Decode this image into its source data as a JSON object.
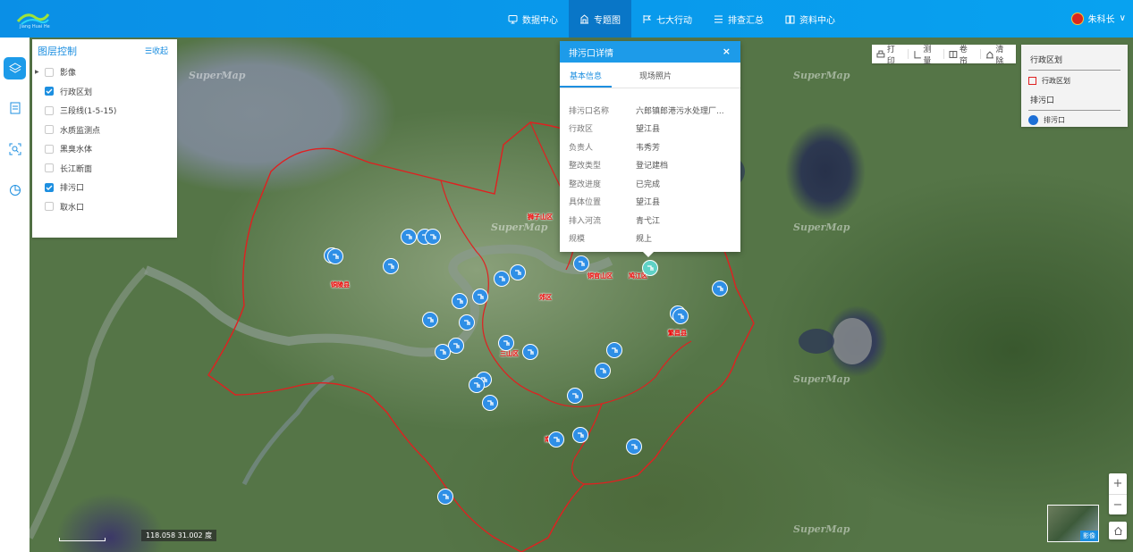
{
  "header": {
    "logo_text": "Jiang Huai He",
    "nav": [
      {
        "label": "数据中心",
        "icon": "monitor-icon"
      },
      {
        "label": "专题图",
        "icon": "building-icon",
        "active": true
      },
      {
        "label": "七大行动",
        "icon": "flag-icon"
      },
      {
        "label": "排查汇总",
        "icon": "list-icon"
      },
      {
        "label": "资料中心",
        "icon": "book-icon"
      }
    ],
    "user": "朱科长",
    "user_chevron": "∨"
  },
  "layer_panel": {
    "title": "图层控制",
    "collapse": "☰收起",
    "items": [
      {
        "label": "影像",
        "checked": false,
        "expandable": true
      },
      {
        "label": "行政区划",
        "checked": true
      },
      {
        "label": "三段线(1-5-15)",
        "checked": false
      },
      {
        "label": "水质监测点",
        "checked": false
      },
      {
        "label": "黑臭水体",
        "checked": false
      },
      {
        "label": "长江断面",
        "checked": false
      },
      {
        "label": "排污口",
        "checked": true
      },
      {
        "label": "取水口",
        "checked": false
      }
    ]
  },
  "popup": {
    "title": "排污口详情",
    "close": "×",
    "tabs": [
      "基本信息",
      "现场照片"
    ],
    "rows": [
      {
        "key": "排污口名称",
        "value": "六郎镇郎港污水处理厂..."
      },
      {
        "key": "行政区",
        "value": "望江县"
      },
      {
        "key": "负责人",
        "value": "韦秀芳"
      },
      {
        "key": "整改类型",
        "value": "登记建档"
      },
      {
        "key": "整改进度",
        "value": "已完成"
      },
      {
        "key": "具体位置",
        "value": "望江县"
      },
      {
        "key": "排入河流",
        "value": "青弋江"
      },
      {
        "key": "规模",
        "value": "规上"
      }
    ]
  },
  "toolbar": [
    {
      "label": "打印",
      "icon": "printer-icon"
    },
    {
      "label": "测量",
      "icon": "ruler-icon"
    },
    {
      "label": "卷帘",
      "icon": "swipe-icon"
    },
    {
      "label": "清除",
      "icon": "eraser-icon"
    }
  ],
  "legend": {
    "groups": [
      {
        "title": "行政区划",
        "item": "行政区划",
        "icon": "red-square-icon"
      },
      {
        "title": "排污口",
        "item": "排污口",
        "icon": "outfall-icon"
      }
    ]
  },
  "map": {
    "watermark": "SuperMap",
    "coords": "118.058  31.002 度",
    "minimap_label": "影像",
    "zoom_in": "+",
    "zoom_out": "−",
    "districts": [
      "铜陵县",
      "狮子山区",
      "铜官山区",
      "郊区",
      "三山区",
      "繁昌县",
      "鸠江区",
      "南陵县"
    ],
    "colors": {
      "accent": "#1d9be9",
      "boundary": "#e02020",
      "marker": "#2f8fe6"
    }
  }
}
